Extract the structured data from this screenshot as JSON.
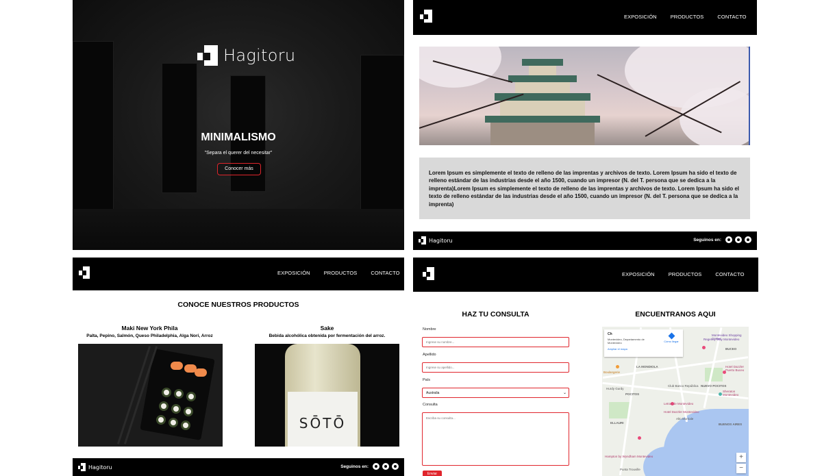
{
  "brand": {
    "name": "Hagitoru"
  },
  "nav": {
    "items": [
      "EXPOSICIÓN",
      "PRODUCTOS",
      "CONTACTO"
    ]
  },
  "hero": {
    "title": "MINIMALISMO",
    "quote": "\"Separa el querer del necesitar\"",
    "button": "Conocer más"
  },
  "about": {
    "text": "Lorem Ipsum es simplemente el texto de relleno de las imprentas y archivos de texto. Lorem Ipsum ha sido el texto de relleno estándar de las industrias desde el año 1500, cuando un impresor (N. del T. persona que se dedica a la imprenta)Lorem Ipsum es simplemente el texto de relleno de las imprentas y archivos de texto. Lorem Ipsum ha sido el texto de relleno estándar de las industrias desde el año 1500, cuando un impresor (N. del T. persona que se dedica a la imprenta)"
  },
  "footer": {
    "follow_label": "Seguinos en:",
    "social_icons": [
      "instagram-icon",
      "youtube-icon",
      "twitter-icon"
    ]
  },
  "products": {
    "title": "CONOCE NUESTROS PRODUCTOS",
    "items": [
      {
        "name": "Maki New York Phila",
        "desc": "Palta, Pepino, Salmón, Queso Philadelphia, Alga Nori, Arroz"
      },
      {
        "name": "Sake",
        "desc": "Bebida alcohólica obtenida por fermentación del arroz.",
        "bottle_label": "SŌTŌ"
      }
    ]
  },
  "contact": {
    "title": "HAZ TU CONSULTA",
    "fields": {
      "nombre_label": "Nombre",
      "nombre_placeholder": "Ingrese su nombre...",
      "apellido_label": "Apellido",
      "apellido_placeholder": "Ingrese su apellido...",
      "pais_label": "País",
      "pais_value": "Australia",
      "consulta_label": "Consulta",
      "consulta_placeholder": "Escriba su consulta..."
    },
    "submit": "Enviar"
  },
  "location": {
    "title": "ENCUENTRANOS AQUI",
    "map": {
      "place_title": "Ch",
      "place_address": "Montevideo, Departamento de Montevideo",
      "directions": "Cómo llegar",
      "enlarge": "Ampliar el mapa",
      "labels": [
        "LA MONDIOLA",
        "POCITOS",
        "NUEVO POCITOS",
        "BUCEO",
        "BUENOS AIRES",
        "ELLAURI",
        "Montevideo Shopping Center",
        "Regency Way Montevideo",
        "Letras de Montevideo",
        "Club Banco República",
        "Hotel Dazzler Puerto Buceo",
        "Sheraton Montevideo",
        "Hotel Dazzler Montevideo",
        "Alto Morriale",
        "Hampton by Wyndham Montevideo",
        "Punta Trouville",
        "Boulangerie",
        "Hurdy Gurdy"
      ],
      "zoom_in": "+",
      "zoom_out": "−"
    }
  },
  "colors": {
    "accent": "#e0252c",
    "dark": "#000000",
    "textbox": "#d9d9d9"
  }
}
